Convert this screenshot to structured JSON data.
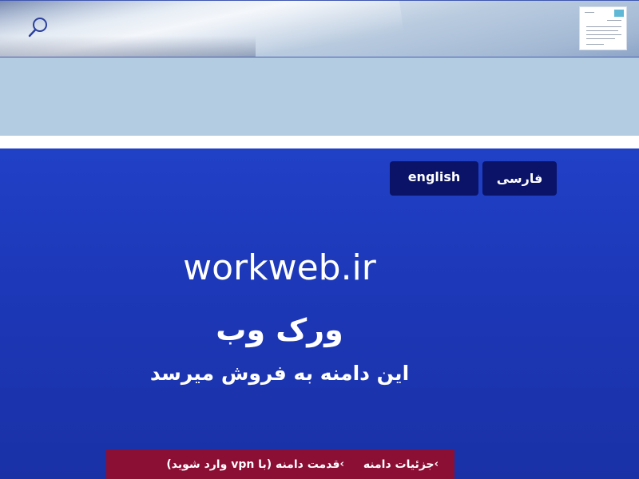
{
  "header": {
    "search_icon": "search-icon",
    "thumbnail_icon": "document-thumbnail-icon"
  },
  "language_switch": {
    "english_label": "english",
    "farsi_label": "فارسی"
  },
  "hero": {
    "domain": "workweb.ir",
    "site_name": "ورک وب",
    "tagline": "این دامنه به فروش میرسد"
  },
  "actions": {
    "details_label": "جزئیات دامنه",
    "visit_label": "قدمت دامنه (با vpn وارد شوید)",
    "chevron_icon": "chevron-left-icon"
  },
  "colors": {
    "hero_blue": "#1f3cc0",
    "lang_button": "#0a1368",
    "action_bar": "#8b0e35",
    "header_light": "#b4cce1"
  }
}
